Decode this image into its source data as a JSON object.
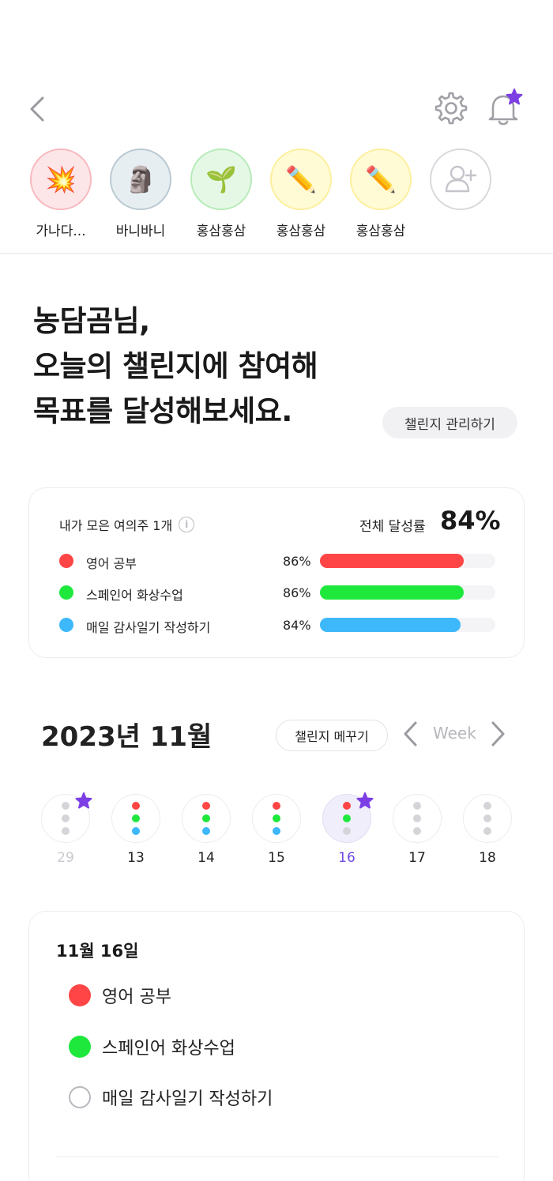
{
  "header": {
    "back_icon": "chevron-left-icon",
    "settings_icon": "gear-icon",
    "notification_icon": "bell-icon",
    "notification_badge_color": "#7b3fe4"
  },
  "friends": [
    {
      "name": "가나다...",
      "emoji": "💥",
      "ring": "#fde6e8",
      "ring_border": "#f7b9bf"
    },
    {
      "name": "바니바니",
      "emoji": "🗿",
      "ring": "#e6eef2",
      "ring_border": "#b9c9d1"
    },
    {
      "name": "홍삼홍삼",
      "emoji": "🌱",
      "ring": "#e5f8e6",
      "ring_border": "#b7ebb8"
    },
    {
      "name": "홍삼홍삼",
      "emoji": "✏️",
      "ring": "#fffbd5",
      "ring_border": "#fcef9d"
    },
    {
      "name": "홍삼홍삼",
      "emoji": "✏️",
      "ring": "#fffbd5",
      "ring_border": "#fcef9d"
    }
  ],
  "add_friend_icon": "add-user-icon",
  "greeting": {
    "line1": "농담곰님,",
    "line2": "오늘의 챌린지에 참여해",
    "line3": "목표를 달성해보세요."
  },
  "manage_button": "챌린지 관리하기",
  "summary": {
    "beads_label": "내가 모은 여의주 1개",
    "overall_label": "전체 달성률",
    "overall_value": "84%",
    "challenges": [
      {
        "name": "영어 공부",
        "percent_label": "86%",
        "percent": 86,
        "color": "#ff4545"
      },
      {
        "name": "스페인어 화상수업",
        "percent_label": "86%",
        "percent": 86,
        "color": "#1fe83d"
      },
      {
        "name": "매일 감사일기 작성하기",
        "percent_label": "84%",
        "percent": 84,
        "color": "#3db8fb"
      }
    ]
  },
  "calendar": {
    "month_title": "2023년 11월",
    "decorate_button": "챌린지 메꾸기",
    "view_label": "Week",
    "days": [
      {
        "num": "29",
        "muted": true,
        "selected": false,
        "star": true,
        "dots": [
          "#d5d5d9",
          "#d5d5d9",
          "#d5d5d9"
        ]
      },
      {
        "num": "13",
        "muted": false,
        "selected": false,
        "star": false,
        "dots": [
          "#ff4545",
          "#1fe83d",
          "#3db8fb"
        ]
      },
      {
        "num": "14",
        "muted": false,
        "selected": false,
        "star": false,
        "dots": [
          "#ff4545",
          "#1fe83d",
          "#3db8fb"
        ]
      },
      {
        "num": "15",
        "muted": false,
        "selected": false,
        "star": false,
        "dots": [
          "#ff4545",
          "#1fe83d",
          "#3db8fb"
        ]
      },
      {
        "num": "16",
        "muted": false,
        "selected": true,
        "star": true,
        "dots": [
          "#ff4545",
          "#1fe83d",
          "#d5d5d9"
        ]
      },
      {
        "num": "17",
        "muted": false,
        "selected": false,
        "star": false,
        "dots": [
          "#d5d5d9",
          "#d5d5d9",
          "#d5d5d9"
        ]
      },
      {
        "num": "18",
        "muted": false,
        "selected": false,
        "star": false,
        "dots": [
          "#d5d5d9",
          "#d5d5d9",
          "#d5d5d9"
        ]
      }
    ],
    "star_color": "#7b3fe4",
    "selected_color": "#6f4ae0"
  },
  "detail": {
    "date": "11월 16일",
    "todos": [
      {
        "name": "영어 공부",
        "done": true,
        "color": "#ff4545"
      },
      {
        "name": "스페인어 화상수업",
        "done": true,
        "color": "#1fe83d"
      },
      {
        "name": "매일 감사일기 작성하기",
        "done": false,
        "color": ""
      }
    ]
  }
}
